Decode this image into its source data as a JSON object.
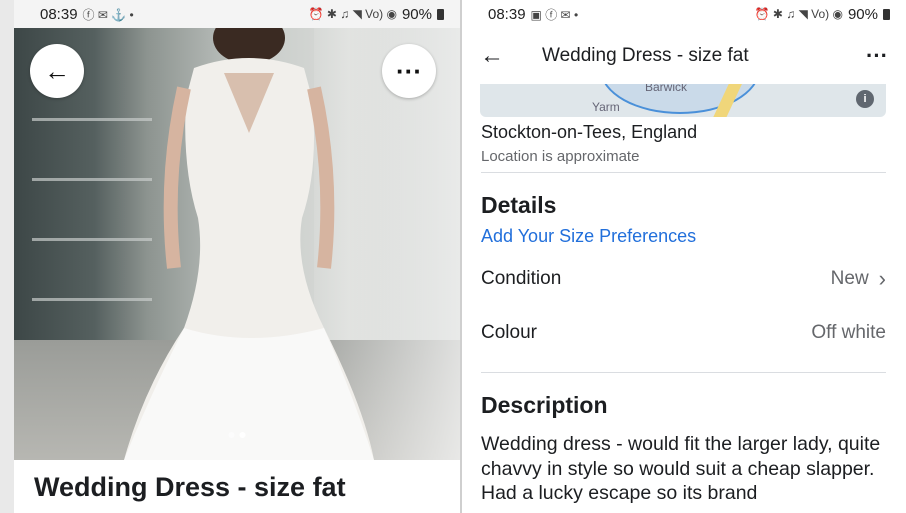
{
  "left_phone": {
    "status": {
      "time": "08:39",
      "icons": "ⓕ ✉ ⚓ •",
      "right_icons": "⏰ ✱ ♫ ◥ Vo) ◉",
      "battery": "90%"
    },
    "listing_title": "Wedding Dress - size fat",
    "photo_dots": 2
  },
  "right_phone": {
    "status": {
      "time": "08:39",
      "icons": "▣ ⓕ ✉ •",
      "right_icons": "⏰ ✱ ♫ ◥ Vo) ◉",
      "battery": "90%"
    },
    "header": {
      "title": "Wedding Dress - size fat"
    },
    "map": {
      "label_top": "Barwick",
      "label_bottom": "Yarm"
    },
    "location": "Stockton-on-Tees, England",
    "location_note": "Location is approximate",
    "details": {
      "heading": "Details",
      "size_link": "Add Your Size Preferences",
      "rows": [
        {
          "label": "Condition",
          "value": "New"
        },
        {
          "label": "Colour",
          "value": "Off white"
        }
      ]
    },
    "description": {
      "heading": "Description",
      "text": "Wedding dress - would fit the larger lady, quite chavvy in style so would suit a cheap slapper. Had a lucky escape so its brand"
    }
  },
  "colors": {
    "link": "#216fdb",
    "text": "#1c1e21",
    "secondary": "#65676b"
  }
}
